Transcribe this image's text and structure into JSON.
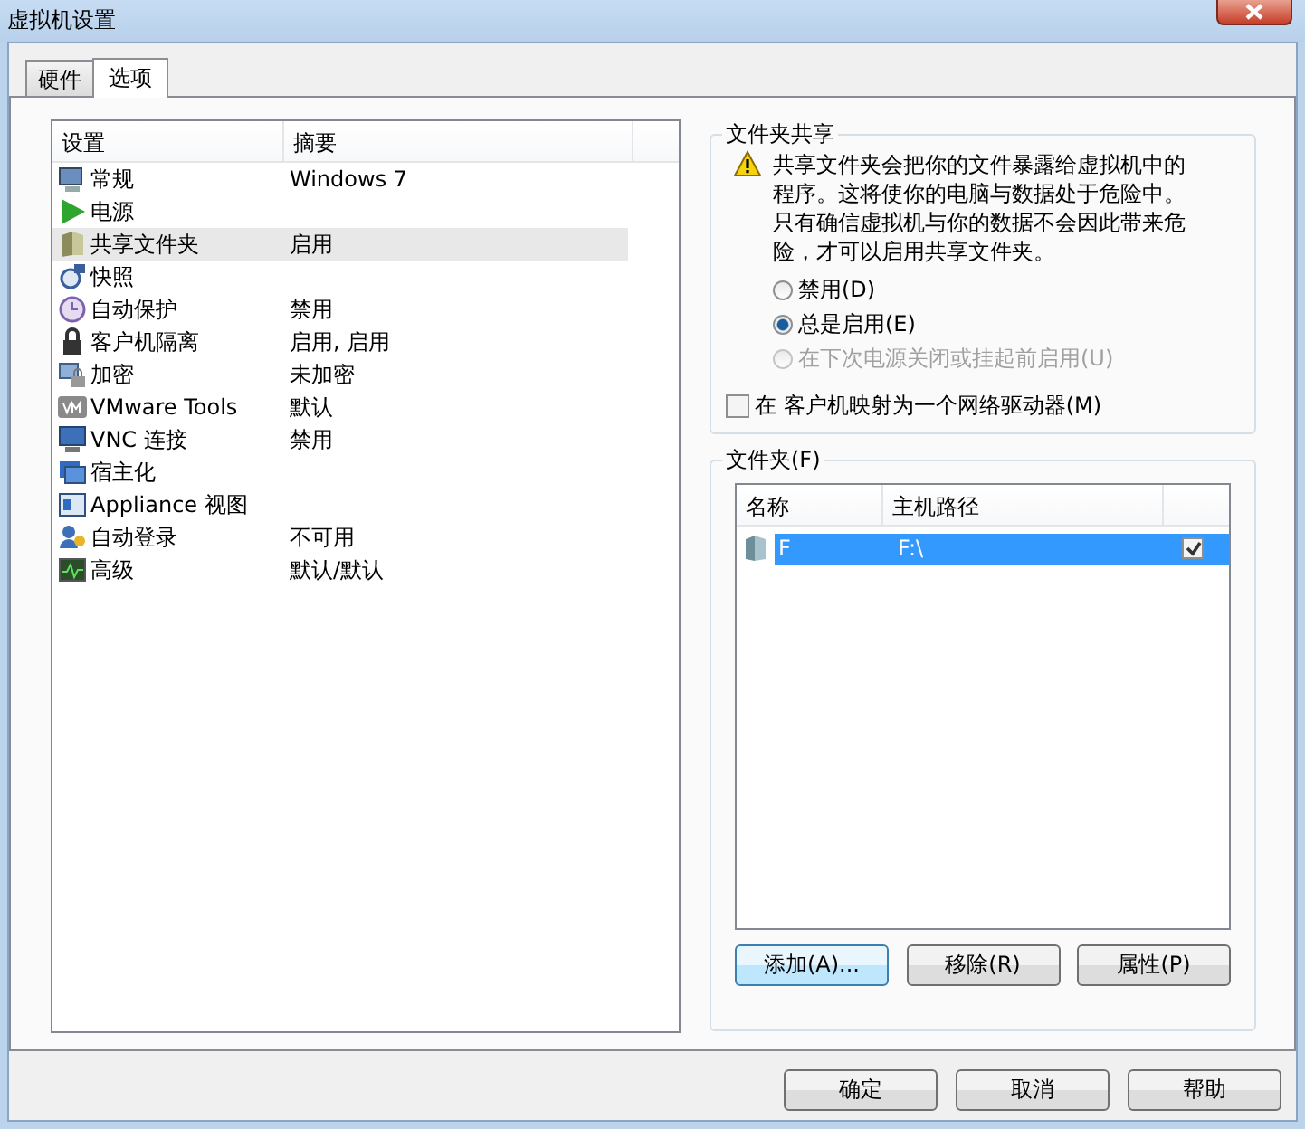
{
  "window": {
    "title": "虚拟机设置"
  },
  "tabs": [
    {
      "label": "硬件",
      "selected": false
    },
    {
      "label": "选项",
      "selected": true
    }
  ],
  "settings": {
    "columns": [
      "设置",
      "摘要"
    ],
    "items": [
      {
        "name": "常规",
        "summary": "Windows 7",
        "selected": false
      },
      {
        "name": "电源",
        "selected": false
      },
      {
        "name": "共享文件夹",
        "summary": "启用",
        "selected": true
      },
      {
        "name": "快照",
        "selected": false
      },
      {
        "name": "自动保护",
        "summary": "禁用",
        "selected": false
      },
      {
        "name": "客户机隔离",
        "summary": "启用, 启用",
        "selected": false
      },
      {
        "name": "加密",
        "summary": "未加密",
        "selected": false
      },
      {
        "name": "VMware Tools",
        "summary": "默认",
        "selected": false
      },
      {
        "name": "VNC 连接",
        "summary": "禁用",
        "selected": false
      },
      {
        "name": "宿主化",
        "selected": false
      },
      {
        "name": "Appliance 视图",
        "selected": false
      },
      {
        "name": "自动登录",
        "summary": "不可用",
        "selected": false
      },
      {
        "name": "高级",
        "summary": "默认/默认",
        "selected": false
      }
    ]
  },
  "folder_sharing": {
    "title": "文件夹共享",
    "warning": "共享文件夹会把你的文件暴露给虚拟机中的程序。这将使你的电脑与数据处于危险中。只有确信虚拟机与你的数据不会因此带来危险，才可以启用共享文件夹。",
    "options": [
      {
        "label": "禁用(D)",
        "selected": false,
        "disabled": false
      },
      {
        "label": "总是启用(E)",
        "selected": true,
        "disabled": false
      },
      {
        "label": "在下次电源关闭或挂起前启用(U)",
        "selected": false,
        "disabled": true
      }
    ],
    "map_drive": {
      "label": "在 客户机映射为一个网络驱动器(M)",
      "checked": false
    }
  },
  "folders": {
    "title": "文件夹(F)",
    "columns": [
      "名称",
      "主机路径"
    ],
    "rows": [
      {
        "name": "F",
        "path": "F:\\",
        "enabled": true,
        "selected": true
      }
    ],
    "buttons": [
      {
        "label": "添加(A)...",
        "focused": true
      },
      {
        "label": "移除(R)",
        "focused": false
      },
      {
        "label": "属性(P)",
        "focused": false
      }
    ]
  },
  "buttons": [
    "确定",
    "取消",
    "帮助"
  ]
}
